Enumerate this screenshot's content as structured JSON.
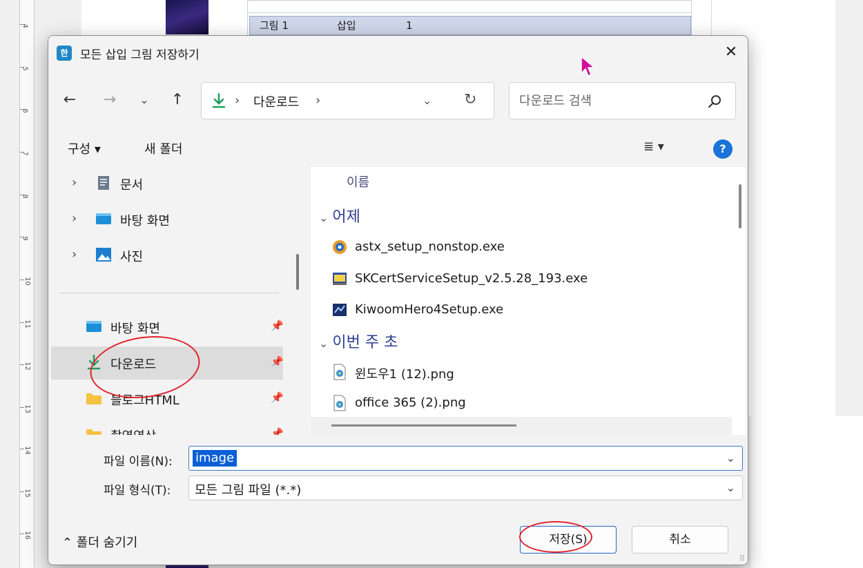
{
  "background": {
    "ruler_numbers": [
      "4",
      "5",
      "6",
      "7",
      "8",
      "9",
      "10",
      "11",
      "12",
      "13",
      "14",
      "15",
      "16"
    ],
    "table_row": {
      "name": "그림 1",
      "type": "삽입",
      "count": "1"
    }
  },
  "dialog": {
    "app_icon_glyph": "한",
    "title": "모든 삽입 그림 저장하기",
    "close_glyph": "✕"
  },
  "nav": {
    "back_glyph": "←",
    "forward_glyph": "→",
    "recent_glyph": "⌄",
    "up_glyph": "↑"
  },
  "address": {
    "sep": "›",
    "current": "다운로드",
    "dropdown_glyph": "⌄",
    "refresh_glyph": "↻"
  },
  "search": {
    "placeholder": "다운로드 검색"
  },
  "toolbar": {
    "organize": "구성 ▾",
    "new_folder": "새 폴더",
    "view": "≣ ▾",
    "help": "?"
  },
  "sidebar": {
    "items": [
      {
        "label": "문서"
      },
      {
        "label": "바탕 화면"
      },
      {
        "label": "사진"
      },
      {
        "label": "바탕 화면"
      },
      {
        "label": "다운로드"
      },
      {
        "label": "블로그HTML"
      },
      {
        "label": "촬영영상"
      }
    ],
    "chevron": "›",
    "pin_glyph": "📌"
  },
  "files": {
    "column_name": "이름",
    "groups": [
      {
        "title": "어제",
        "items": [
          "astx_setup_nonstop.exe",
          "SKCertServiceSetup_v2.5.28_193.exe",
          "KiwoomHero4Setup.exe"
        ]
      },
      {
        "title": "이번 주 초",
        "items": [
          "윈도우1 (12).png",
          "office 365 (2).png"
        ]
      }
    ],
    "group_chevron": "⌄"
  },
  "form": {
    "filename_label": "파일 이름(N):",
    "filename_value": "image",
    "filetype_label": "파일 형식(T):",
    "filetype_value": "모든 그림 파일 (*.*)",
    "dropdown_glyph": "⌄"
  },
  "footer": {
    "hide_folders": "⌃  폴더 숨기기",
    "save": "저장(S)",
    "cancel": "취소",
    "grip": "⠿"
  },
  "colors": {
    "accent": "#0a5fd6",
    "annotation": "#e3222d",
    "download_green": "#1a9e5c",
    "cursor_magenta": "#d0109a"
  }
}
